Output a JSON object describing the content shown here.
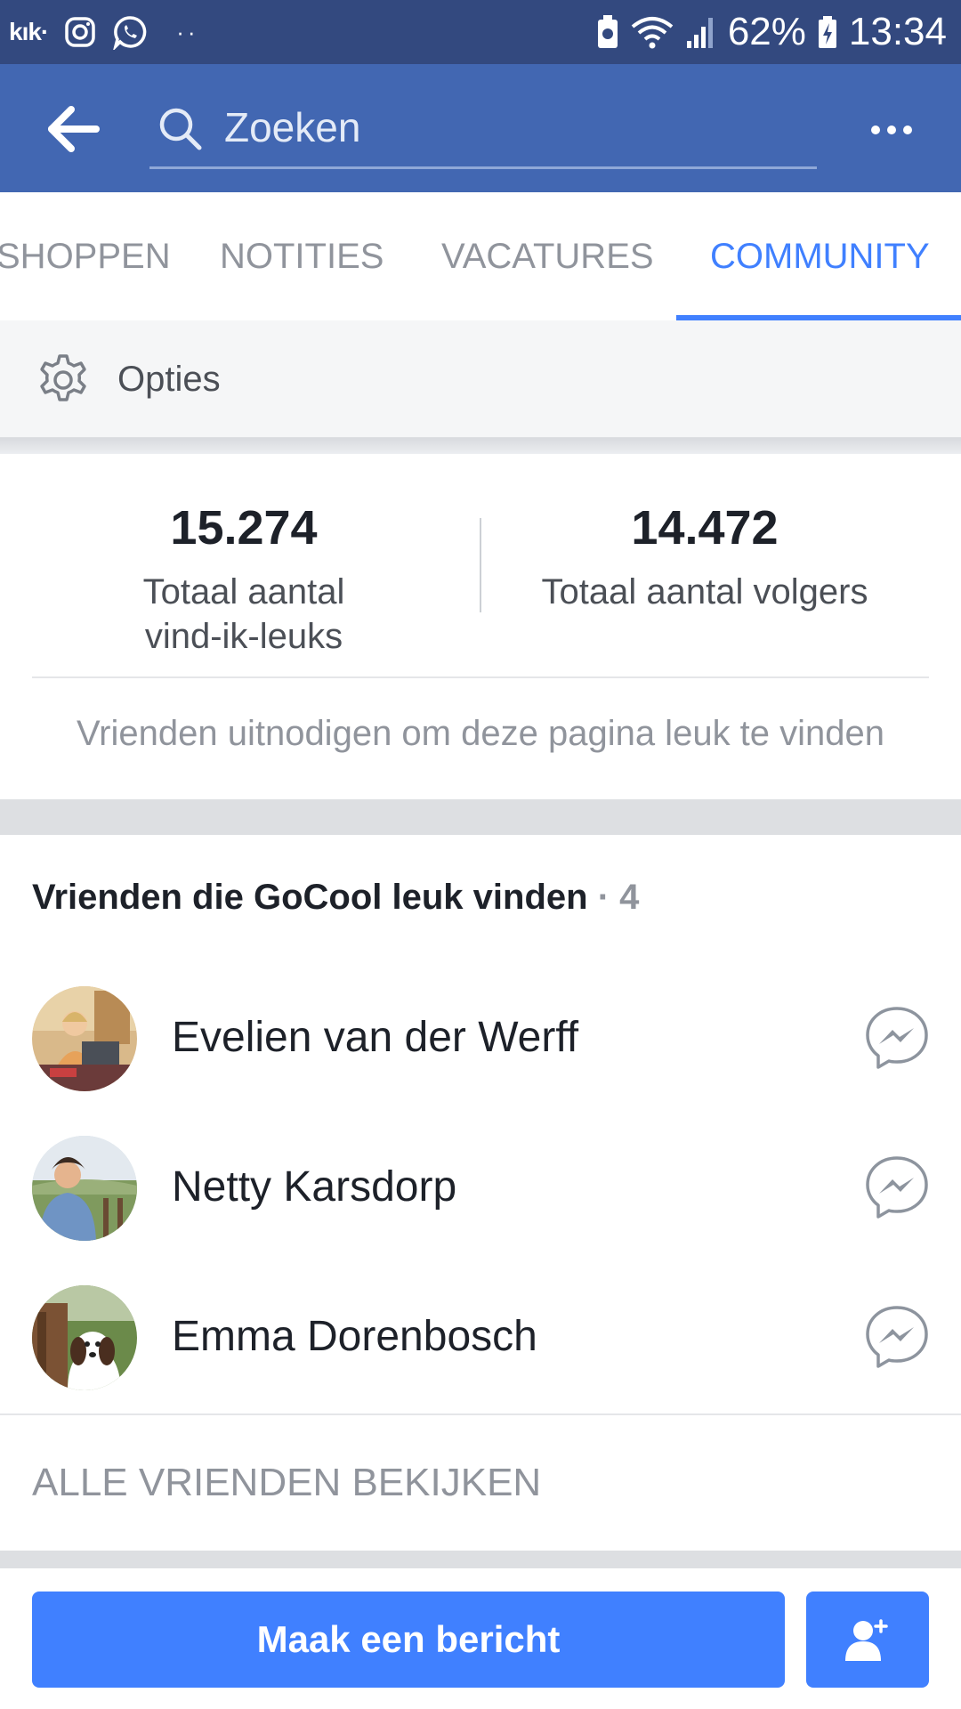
{
  "status_bar": {
    "app_label": "kık·",
    "overflow_dots": "··",
    "battery_percent": "62%",
    "time": "13:34",
    "icons": [
      "kik-icon",
      "instagram-icon",
      "whatsapp-icon",
      "battery-saver-icon",
      "wifi-icon",
      "signal-icon",
      "battery-charging-icon"
    ]
  },
  "header": {
    "search_placeholder": "Zoeken",
    "icons": [
      "back-arrow-icon",
      "search-icon",
      "more-options-icon"
    ],
    "bar_color": "#4267b2"
  },
  "tabs": [
    {
      "label": "SHOPPEN",
      "active": false
    },
    {
      "label": "NOTITIES",
      "active": false
    },
    {
      "label": "VACATURES",
      "active": false
    },
    {
      "label": "COMMUNITY",
      "active": true
    }
  ],
  "options": {
    "label": "Opties",
    "icon": "gear-icon"
  },
  "stats": {
    "likes": {
      "value": "15.274",
      "label_line1": "Totaal aantal",
      "label_line2": "vind-ik-leuks"
    },
    "followers": {
      "value": "14.472",
      "label": "Totaal aantal volgers"
    },
    "invite_text": "Vrienden uitnodigen om deze pagina leuk te vinden"
  },
  "friends": {
    "title": "Vrienden die GoCool leuk vinden",
    "count": "· 4",
    "items": [
      {
        "name": "Evelien van der Werff"
      },
      {
        "name": "Netty Karsdorp"
      },
      {
        "name": "Emma Dorenbosch"
      }
    ],
    "view_all": "ALLE VRIENDEN BEKIJKEN"
  },
  "bottom_bar": {
    "message_button": "Maak een bericht",
    "add_friend_icon": "add-person-icon",
    "accent_color": "#4080ff"
  }
}
